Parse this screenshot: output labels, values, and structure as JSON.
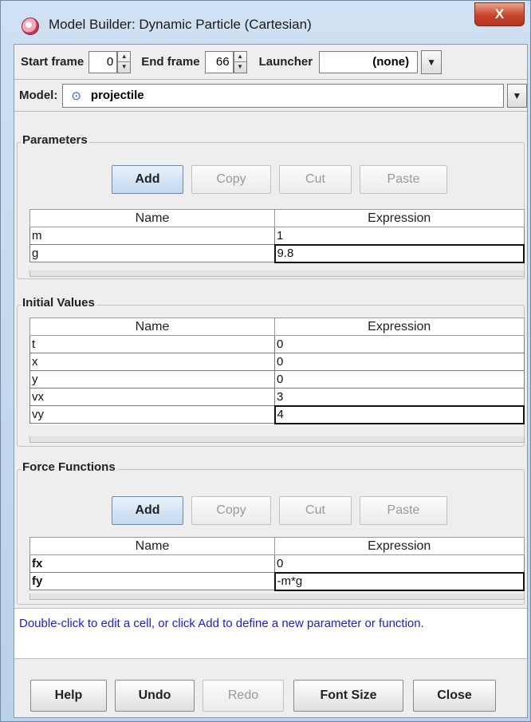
{
  "window": {
    "title": "Model Builder: Dynamic Particle (Cartesian)",
    "close_label": "X"
  },
  "frames": {
    "start_label": "Start frame",
    "start_value": "0",
    "end_label": "End frame",
    "end_value": "66",
    "launcher_label": "Launcher",
    "launcher_value": "(none)"
  },
  "model": {
    "label": "Model:",
    "value": "projectile"
  },
  "parameters": {
    "title": "Parameters",
    "buttons": {
      "add": "Add",
      "copy": "Copy",
      "cut": "Cut",
      "paste": "Paste"
    },
    "columns": [
      "Name",
      "Expression"
    ],
    "rows": [
      {
        "name": "m",
        "expression": "1"
      },
      {
        "name": "g",
        "expression": "9.8"
      }
    ]
  },
  "initial_values": {
    "title": "Initial Values",
    "columns": [
      "Name",
      "Expression"
    ],
    "rows": [
      {
        "name": "t",
        "expression": "0"
      },
      {
        "name": "x",
        "expression": "0"
      },
      {
        "name": "y",
        "expression": "0"
      },
      {
        "name": "vx",
        "expression": "3"
      },
      {
        "name": "vy",
        "expression": "4"
      }
    ]
  },
  "force_functions": {
    "title": "Force Functions",
    "buttons": {
      "add": "Add",
      "copy": "Copy",
      "cut": "Cut",
      "paste": "Paste"
    },
    "columns": [
      "Name",
      "Expression"
    ],
    "rows": [
      {
        "name": "fx",
        "expression": "0"
      },
      {
        "name": "fy",
        "expression": "-m*g"
      }
    ]
  },
  "hint": "Double-click to edit a cell, or click Add to define a new parameter or function.",
  "footer": {
    "help": "Help",
    "undo": "Undo",
    "redo": "Redo",
    "font_size": "Font Size",
    "close": "Close"
  },
  "colors": {
    "title_bar": "#b9d1ea",
    "close_button": "#c8432a",
    "hint_text": "#2020c8",
    "panel_bg": "#eeeeee"
  }
}
